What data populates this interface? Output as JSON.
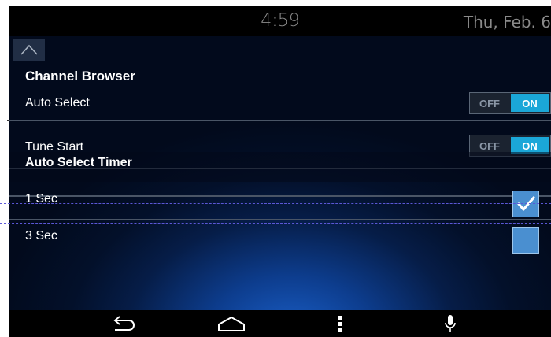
{
  "status_bar": {
    "time": "4:59",
    "date": "Thu, Feb. 6"
  },
  "section_channel_browser": {
    "title": "Channel Browser",
    "rows": [
      {
        "label": "Auto Select",
        "off_label": "OFF",
        "on_label": "ON",
        "value": "ON"
      },
      {
        "label": "Tune Start",
        "off_label": "OFF",
        "on_label": "ON",
        "value": "ON"
      }
    ]
  },
  "section_auto_select_timer": {
    "title": "Auto Select Timer",
    "options": [
      {
        "label": "1 Sec",
        "checked": true
      },
      {
        "label": "3 Sec",
        "checked": false
      }
    ]
  },
  "icons": {
    "up": "chevron-up-icon",
    "back": "back-arrow-icon",
    "home": "home-icon",
    "menu": "menu-dots-icon",
    "voice": "microphone-icon"
  },
  "colors": {
    "toggle_on": "#1ba7d8",
    "checkbox": "#4a8fd0",
    "background": "#061d48"
  }
}
